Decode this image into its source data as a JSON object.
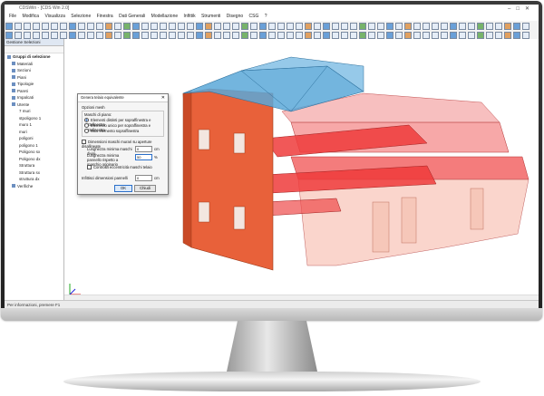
{
  "window": {
    "title": "CDSWin - [CDS Win 2.0]"
  },
  "menu": [
    "File",
    "Modifica",
    "Visualizza",
    "Selezione",
    "Finestra",
    "Dati Generali",
    "Modellazione",
    "Infittik",
    "Strumenti",
    "Disegno",
    "CSG",
    "?"
  ],
  "sidebar": {
    "title": "Gestione Selezioni",
    "items": [
      {
        "label": "Gruppi di selezione",
        "level": 0
      },
      {
        "label": "Materiali",
        "level": 1
      },
      {
        "label": "Sezioni",
        "level": 1
      },
      {
        "label": "Piani",
        "level": 1
      },
      {
        "label": "Tipologie",
        "level": 1
      },
      {
        "label": "Pareti",
        "level": 1
      },
      {
        "label": "Impalcati",
        "level": 1
      },
      {
        "label": "Utente",
        "level": 1
      },
      {
        "label": "7 muri",
        "level": 2
      },
      {
        "label": "stpoligono 1",
        "level": 2
      },
      {
        "label": "muro 1",
        "level": 2
      },
      {
        "label": "muri",
        "level": 2
      },
      {
        "label": "poligoni",
        "level": 2
      },
      {
        "label": "poligono 1",
        "level": 2
      },
      {
        "label": "Poligono sx",
        "level": 2
      },
      {
        "label": "Poligono dx",
        "level": 2
      },
      {
        "label": "Struttura",
        "level": 2
      },
      {
        "label": "Struttura sx",
        "level": 2
      },
      {
        "label": "struttura dx",
        "level": 2
      },
      {
        "label": "Verifiche",
        "level": 1
      }
    ]
  },
  "dialog": {
    "title": "Genera telaio equivalente",
    "section_title": "Opzioni mesh",
    "group_label": "Maschi di piano:",
    "options": [
      "Elementi distinti per sopraffinestra e sottofinestra",
      "Elemento unico per sopraffinestra e sottofinestra",
      "Solo elemento sopraffinestra"
    ],
    "checkbox_label": "Dimensioni maschi murari su aperture disallineate",
    "field1_label": "Lunghezza minima maschi divisi",
    "field1_value": "0",
    "field1_unit": "cm",
    "field2_label": "Lunghezza minima pannello rispetto a maschio originario",
    "field2_value": "50",
    "field2_unit": "%",
    "checkbox2_label": "Controlla eccentricità maschi telaio",
    "field3_label": "Infittisci dimensioni pannelli",
    "field3_value": "0",
    "field3_unit": "cm",
    "ok": "OK",
    "cancel": "Chiudi"
  },
  "statusbar": {
    "text": "Per informazioni, premere F1"
  },
  "colors": {
    "wall": "#e8613a",
    "roof": "#5ba8d8",
    "slab": "#ef4f4f"
  }
}
